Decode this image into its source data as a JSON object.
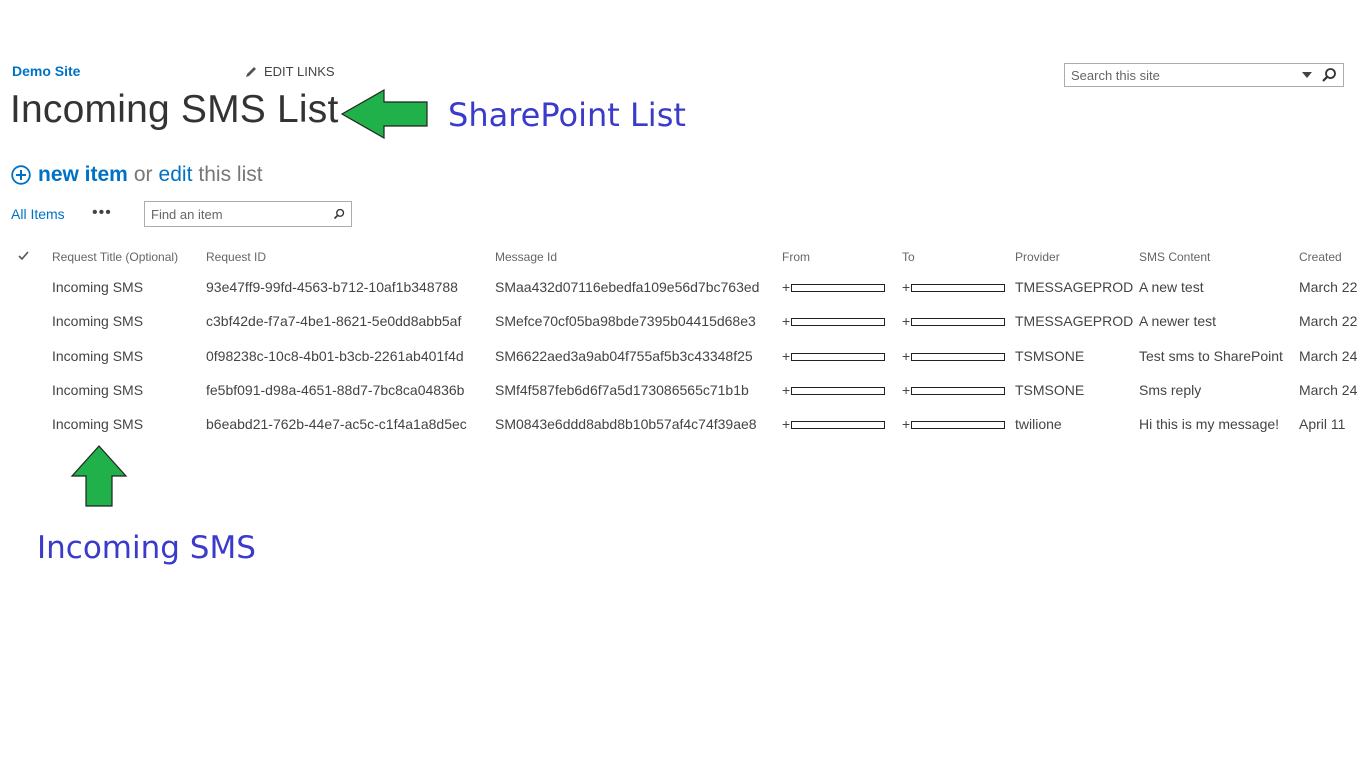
{
  "header": {
    "site_name": "Demo Site",
    "edit_links_label": "EDIT LINKS",
    "search_placeholder": "Search this site",
    "page_title": "Incoming SMS List"
  },
  "annotations": {
    "title_label": "SharePoint List",
    "rows_label": "Incoming SMS",
    "arrow_color": "#21b14a",
    "label_color": "#3a3acb"
  },
  "toolbar": {
    "new_item": "new item",
    "or": "or",
    "edit": "edit",
    "this_list": "this list"
  },
  "views": {
    "all_items": "All Items",
    "more": "•••",
    "find_placeholder": "Find an item"
  },
  "table": {
    "columns": [
      "Request Title (Optional)",
      "Request ID",
      "Message Id",
      "From",
      "To",
      "Provider",
      "SMS Content",
      "Created"
    ],
    "rows": [
      {
        "title": "Incoming SMS",
        "request_id": "93e47ff9-99fd-4563-b712-10af1b348788",
        "message_id": "SMaa432d07116ebedfa109e56d7bc763ed",
        "from": "+",
        "to": "+",
        "provider": "TMESSAGEPROD",
        "content": "A new test",
        "created": "March 22"
      },
      {
        "title": "Incoming SMS",
        "request_id": "c3bf42de-f7a7-4be1-8621-5e0dd8abb5af",
        "message_id": "SMefce70cf05ba98bde7395b04415d68e3",
        "from": "+",
        "to": "+",
        "provider": "TMESSAGEPROD",
        "content": "A newer test",
        "created": "March 22"
      },
      {
        "title": "Incoming SMS",
        "request_id": "0f98238c-10c8-4b01-b3cb-2261ab401f4d",
        "message_id": "SM6622aed3a9ab04f755af5b3c43348f25",
        "from": "+",
        "to": "+",
        "provider": "TSMSONE",
        "content": "Test sms to SharePoint",
        "created": "March 24"
      },
      {
        "title": "Incoming SMS",
        "request_id": "fe5bf091-d98a-4651-88d7-7bc8ca04836b",
        "message_id": "SMf4f587feb6d6f7a5d173086565c71b1b",
        "from": "+",
        "to": "+",
        "provider": "TSMSONE",
        "content": "Sms reply",
        "created": "March 24"
      },
      {
        "title": "Incoming SMS",
        "request_id": "b6eabd21-762b-44e7-ac5c-c1f4a1a8d5ec",
        "message_id": "SM0843e6ddd8abd8b10b57af4c74f39ae8",
        "from": "+",
        "to": "+",
        "provider": "twilione",
        "content": "Hi this is my message!",
        "created": "April 11"
      }
    ]
  }
}
